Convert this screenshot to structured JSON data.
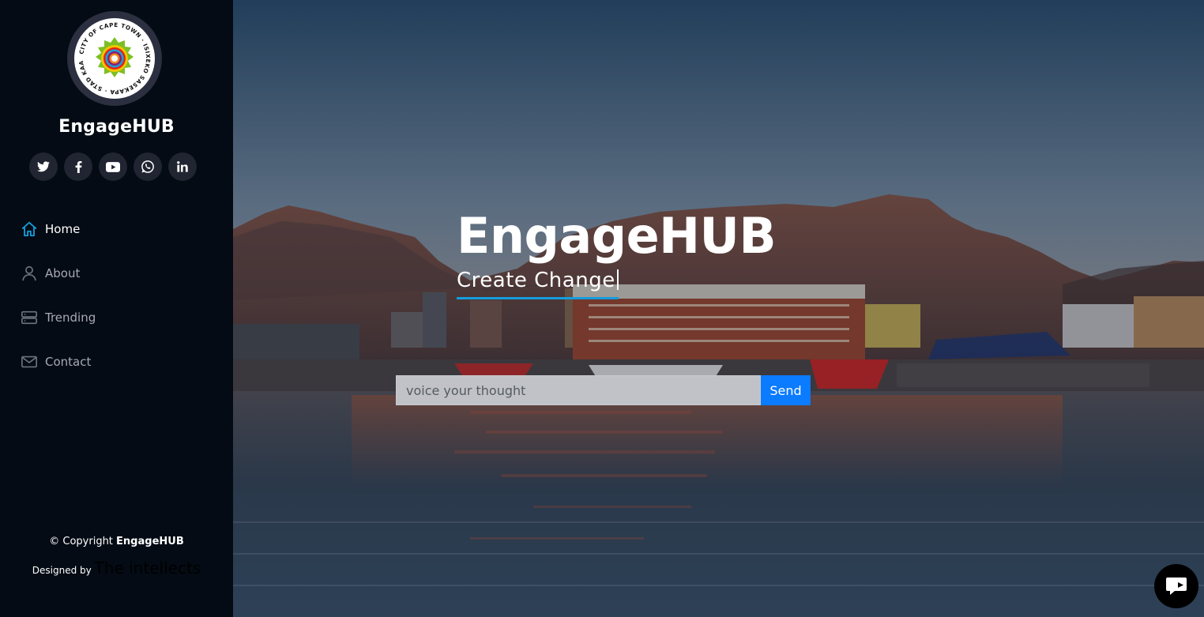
{
  "sidebar": {
    "brand": "EngageHUB",
    "logo_ring_text": "CITY OF CAPE TOWN · ISIXEKO SASEKAPA · STAD KAAPSTAD",
    "social": [
      {
        "name": "twitter",
        "icon": "twitter-icon"
      },
      {
        "name": "facebook",
        "icon": "facebook-icon"
      },
      {
        "name": "youtube",
        "icon": "youtube-icon"
      },
      {
        "name": "whatsapp",
        "icon": "whatsapp-icon"
      },
      {
        "name": "linkedin",
        "icon": "linkedin-icon"
      }
    ],
    "nav": [
      {
        "label": "Home",
        "icon": "home-icon",
        "active": true
      },
      {
        "label": "About",
        "icon": "user-icon",
        "active": false
      },
      {
        "label": "Trending",
        "icon": "server-icon",
        "active": false
      },
      {
        "label": "Contact",
        "icon": "envelope-icon",
        "active": false
      }
    ],
    "footer": {
      "copyright_prefix": "© Copyright",
      "copyright_brand": "EngageHUB",
      "designed_by": "Designed by",
      "designer": "The intellects"
    }
  },
  "hero": {
    "title": "EngageHUB",
    "subtitle": "Create Change",
    "input": {
      "placeholder": "voice your thought",
      "value": ""
    },
    "send_label": "Send"
  },
  "colors": {
    "sidebar_bg": "#040b14",
    "accent": "#149ddd",
    "send_button": "#0b7bff",
    "social_bg": "#212431"
  }
}
